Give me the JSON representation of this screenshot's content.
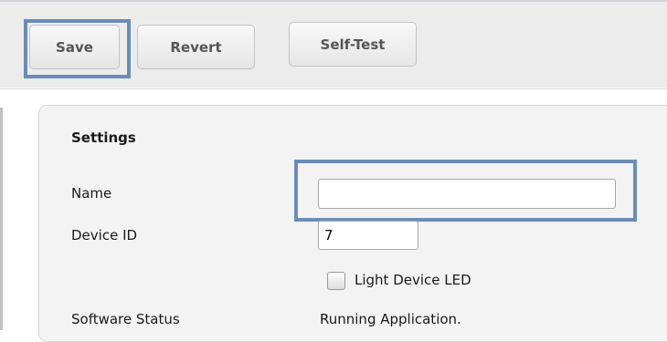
{
  "toolbar": {
    "buttons": {
      "save": "Save",
      "revert": "Revert",
      "self_test": "Self-Test"
    }
  },
  "settings": {
    "title": "Settings",
    "name": {
      "label": "Name",
      "value": "",
      "placeholder": ""
    },
    "device_id": {
      "label": "Device ID",
      "value": "7"
    },
    "light_led": {
      "label": "Light Device LED",
      "checked": false
    },
    "software_status": {
      "label": "Software Status",
      "value": "Running Application."
    }
  },
  "colors": {
    "highlight_border": "#6b8cb8",
    "toolbar_background": "#ececec",
    "panel_background": "#f3f3f3"
  }
}
